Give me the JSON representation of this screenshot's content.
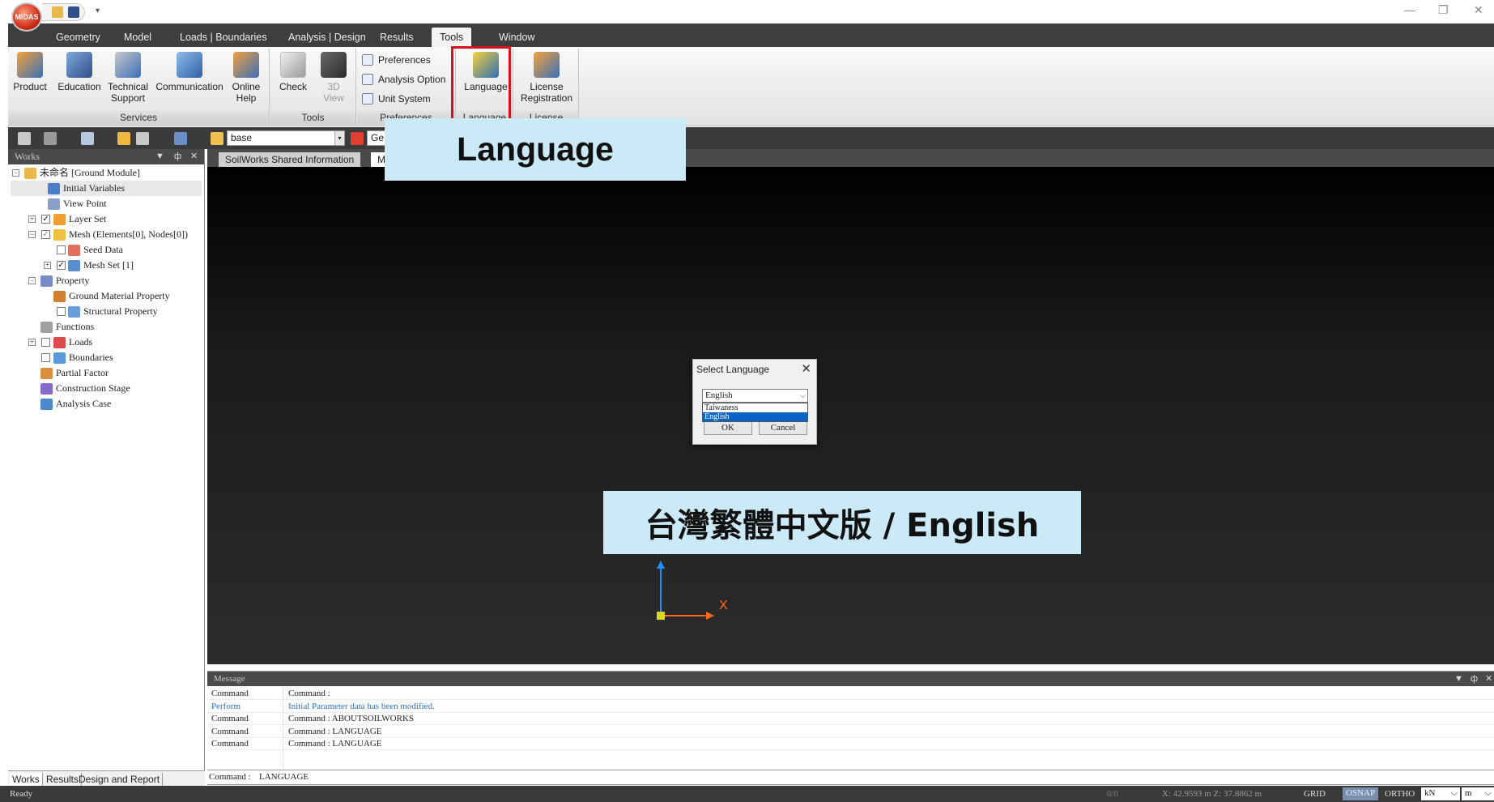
{
  "app": {
    "orb_label": "MIDAS",
    "window_controls": {
      "minimize": "—",
      "restore": "❐",
      "close": "✕"
    }
  },
  "ribbon_tabs": [
    "Geometry",
    "Model",
    "Loads | Boundaries",
    "Analysis | Design",
    "Results",
    "Tools",
    "Window"
  ],
  "active_tab": "Tools",
  "ribbon": {
    "groups": {
      "services": "Services",
      "tools": "Tools",
      "preferences": "Preferences",
      "language": "Language",
      "license": "License"
    },
    "services": {
      "product": "Product",
      "education": "Education",
      "tech1": "Technical",
      "tech2": "Support",
      "communication": "Communication",
      "online1": "Online",
      "online2": "Help"
    },
    "tools": {
      "check": "Check",
      "view1": "3D",
      "view2": "View"
    },
    "preferences": {
      "preferences": "Preferences",
      "analysis_option": "Analysis Option",
      "unit_system": "Unit System"
    },
    "language": {
      "language": "Language"
    },
    "license": {
      "lic1": "License",
      "lic2": "Registration"
    }
  },
  "toolbar": {
    "layer_combo": "base",
    "ge_combo": "Ge"
  },
  "works_panel": {
    "title": "Works",
    "tree": [
      "未命名 [Ground Module]",
      "Initial Variables",
      "View Point",
      "Layer Set",
      "Mesh (Elements[0], Nodes[0])",
      "Seed Data",
      "Mesh Set [1]",
      "Property",
      "Ground Material Property",
      "Structural Property",
      "Functions",
      "Loads",
      "Boundaries",
      "Partial Factor",
      "Construction Stage",
      "Analysis Case"
    ],
    "bottom_tabs": [
      "Works",
      "Results",
      "Design and Report"
    ]
  },
  "doc_tabs": [
    "SoilWorks Shared Information",
    "Mo"
  ],
  "callouts": {
    "top": "Language",
    "bottom": "台灣繁體中文版 / English"
  },
  "axis": {
    "x_label": "X"
  },
  "dialog": {
    "title": "Select Language",
    "close": "✕",
    "selected": "English",
    "options": [
      "Taiwaness",
      "English"
    ],
    "ok": "OK",
    "cancel": "Cancel"
  },
  "message_panel": {
    "title": "Message",
    "rows": [
      {
        "type": "Command",
        "text": "Command :",
        "color": "#222222"
      },
      {
        "type": "Perform",
        "text": "Initial Parameter data has been modified.",
        "color": "#2a6fc9"
      },
      {
        "type": "Command",
        "text": "Command : ABOUTSOILWORKS",
        "color": "#222222"
      },
      {
        "type": "Command",
        "text": "Command : LANGUAGE",
        "color": "#222222"
      },
      {
        "type": "Command",
        "text": "Command : LANGUAGE",
        "color": "#222222"
      }
    ]
  },
  "command_line": {
    "label": "Command :",
    "value": "LANGUAGE"
  },
  "status_bar": {
    "ready": "Ready",
    "count": "0/0",
    "coords": "X: 42.9593 m  Z: 37.8862 m",
    "grid": "GRID",
    "osnap": "OSNAP",
    "ortho": "ORTHO",
    "force_unit": "kN",
    "length_unit": "m"
  },
  "colors": {
    "highlight_box": "#d6101c",
    "callout_bg": "#cbe9f6",
    "dialog_selection": "#0a64c8"
  }
}
